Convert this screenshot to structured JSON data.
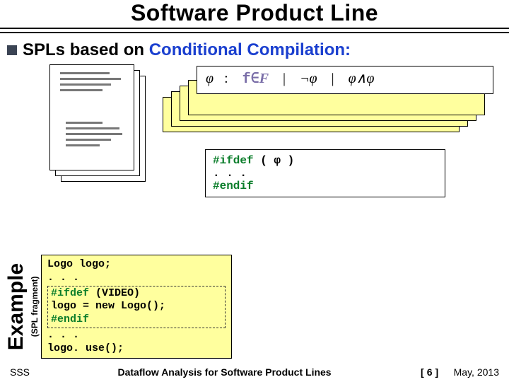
{
  "title": "Software Product Line",
  "bullet_prefix": "SPLs based on ",
  "bullet_blue": "Conditional Compilation:",
  "grammar": {
    "phi": "φ",
    "colon": ":",
    "f": "f",
    "in": "∈",
    "F": "F",
    "pipe1": "|",
    "neg": "¬φ",
    "pipe2": "|",
    "and": "φ∧φ"
  },
  "codebox": {
    "l1a": "#ifdef",
    "l1b": " ( φ )",
    "l2": " . . .",
    "l3": "#endif"
  },
  "example_label": "Example",
  "example_sub": "(SPL fragment)",
  "code2": {
    "l1": "Logo logo;",
    "l2": ". . .",
    "l3a": "#ifdef",
    "l3b": " (VIDEO)",
    "l4": "  logo = new Logo();",
    "l5": "#endif",
    "l6": ". . .",
    "l7": "logo. use();"
  },
  "footer_left": "SSS",
  "footer_mid": "Dataflow Analysis for Software Product Lines",
  "footer_page_l": "[",
  "footer_page_n": "6",
  "footer_page_r": "]",
  "footer_right": "May, 2013"
}
